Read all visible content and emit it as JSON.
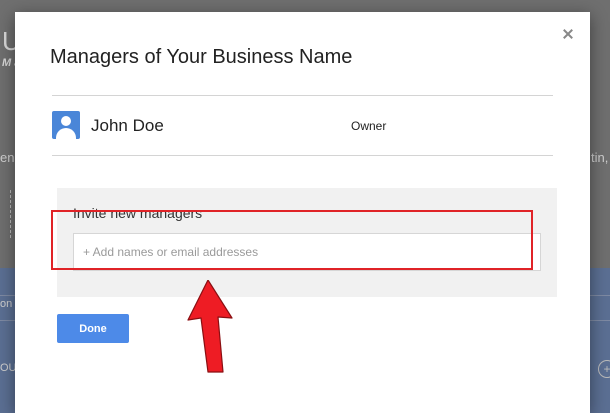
{
  "background": {
    "big_letter": "U",
    "italic_text": "M a",
    "left_snippet": "enc",
    "right_snippet": "tin,",
    "row_snippet_1": "on",
    "row_snippet_2": "OU"
  },
  "dialog": {
    "title": "Managers of Your Business Name",
    "close_icon": "close-icon",
    "managers": [
      {
        "name": "John Doe",
        "role": "Owner",
        "avatar_icon": "person-icon"
      }
    ],
    "invite": {
      "label": "Invite new managers",
      "placeholder": "+ Add names or email addresses",
      "value": ""
    },
    "done_label": "Done"
  },
  "annotation": {
    "highlight_color": "#e02327",
    "arrow_icon": "red-arrow-icon"
  },
  "colors": {
    "accent": "#4d8ae8",
    "avatar": "#4a86d8",
    "highlight": "#e02327"
  }
}
